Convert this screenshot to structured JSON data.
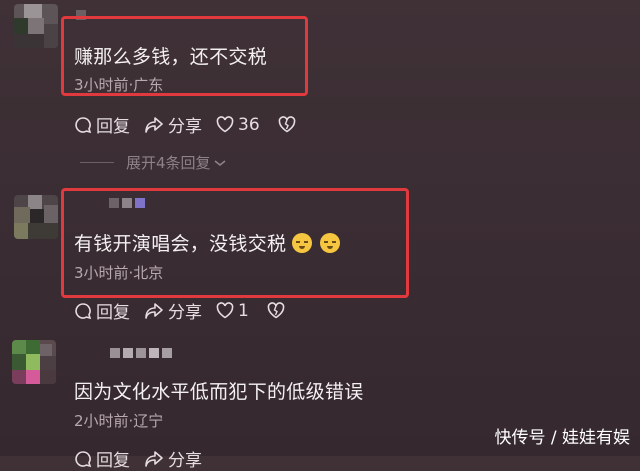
{
  "comments": [
    {
      "text": "赚那么多钱，还不交税",
      "meta": "3小时前·广东",
      "reply_label": "回复",
      "share_label": "分享",
      "likes": "36"
    },
    {
      "text": "有钱开演唱会，没钱交税",
      "meta": "3小时前·北京",
      "reply_label": "回复",
      "share_label": "分享",
      "likes": "1",
      "emoji": [
        "sleepy-face-emoji",
        "sleepy-face-emoji"
      ]
    },
    {
      "text": "因为文化水平低而犯下的低级错误",
      "meta": "2小时前·辽宁",
      "reply_label": "回复",
      "share_label": "分享"
    }
  ],
  "expand_replies": "展开4条回复",
  "watermark": "快传号 / 娃娃有娱",
  "colors": {
    "background": "#3a2d33",
    "highlight_border": "#e0393e",
    "meta_text": "#b7a9ae"
  }
}
